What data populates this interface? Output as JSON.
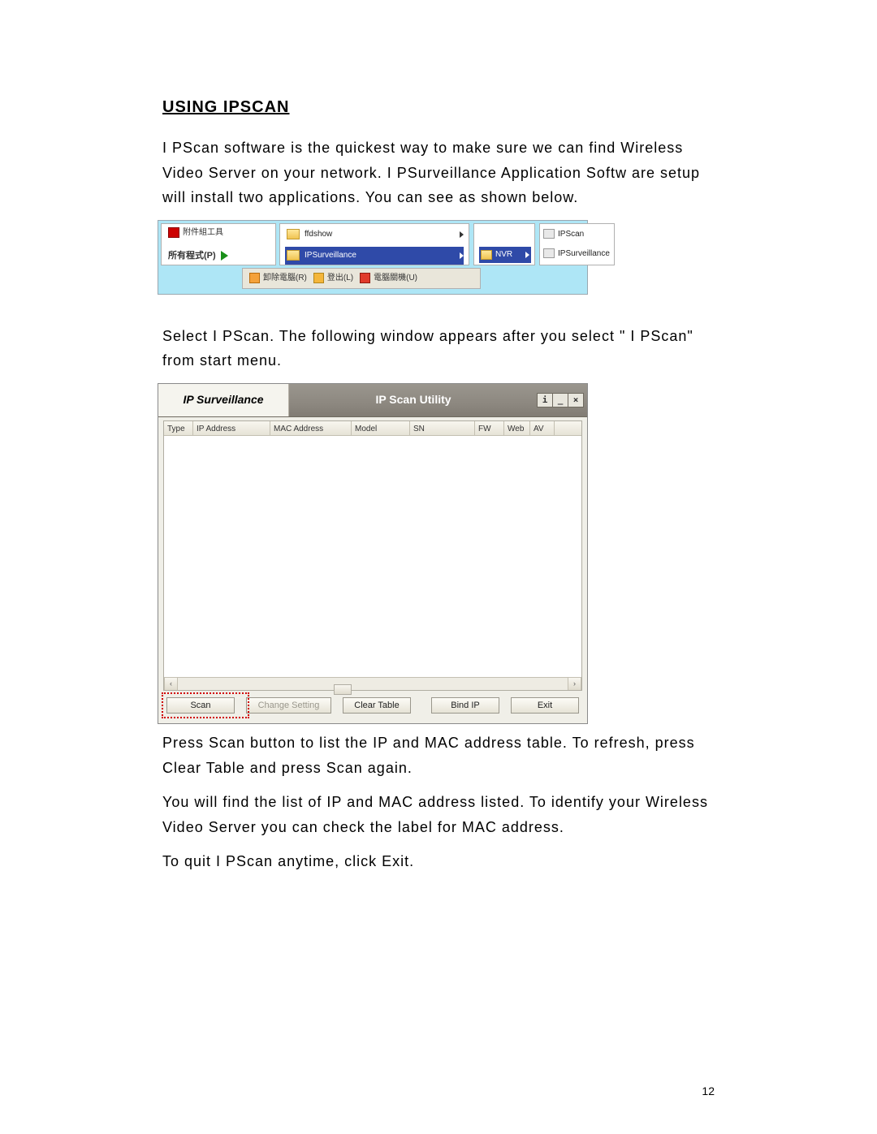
{
  "heading": "USING IPSCAN",
  "para1": "I PScan software is the quickest way to make sure we can find Wireless Video Server on your network. I PSurveillance Application Softw are setup will install two applications. You can see as shown below.",
  "startmenu": {
    "tools_label": "附件組工具",
    "all_programs": "所有程式(P)",
    "ffdshow": "ffdshow",
    "ipsurveillance": "IPSurveillance",
    "nvr": "NVR",
    "ipscan": "IPScan",
    "ipsurv2": "IPSurveillance",
    "logoff_cn": "卸除電腦(R)",
    "logout_cn": "登出(L)",
    "shutdown_cn": "電腦關機(U)"
  },
  "para2": "Select I PScan. The following window appears after you select \" I PScan\" from start menu.",
  "ipscan": {
    "brand": "IP Surveillance",
    "title": "IP Scan Utility",
    "win_info": "i",
    "win_min": "_",
    "win_close": "×",
    "columns": {
      "type": "Type",
      "ip": "IP Address",
      "mac": "MAC Address",
      "model": "Model",
      "sn": "SN",
      "fw": "FW",
      "web": "Web",
      "av": "AV"
    },
    "hs_left": "‹",
    "hs_right": "›",
    "buttons": {
      "scan": "Scan",
      "change": "Change Setting",
      "clear": "Clear Table",
      "bind": "Bind IP",
      "exit": "Exit"
    }
  },
  "para3": "Press Scan button to list the IP and MAC address table. To refresh, press Clear Table and press Scan again.",
  "para4": "You will find the list of IP and MAC address listed. To identify your Wireless Video Server you can check the label for MAC address.",
  "para5": "To quit I PScan anytime, click Exit.",
  "page_number": "12"
}
